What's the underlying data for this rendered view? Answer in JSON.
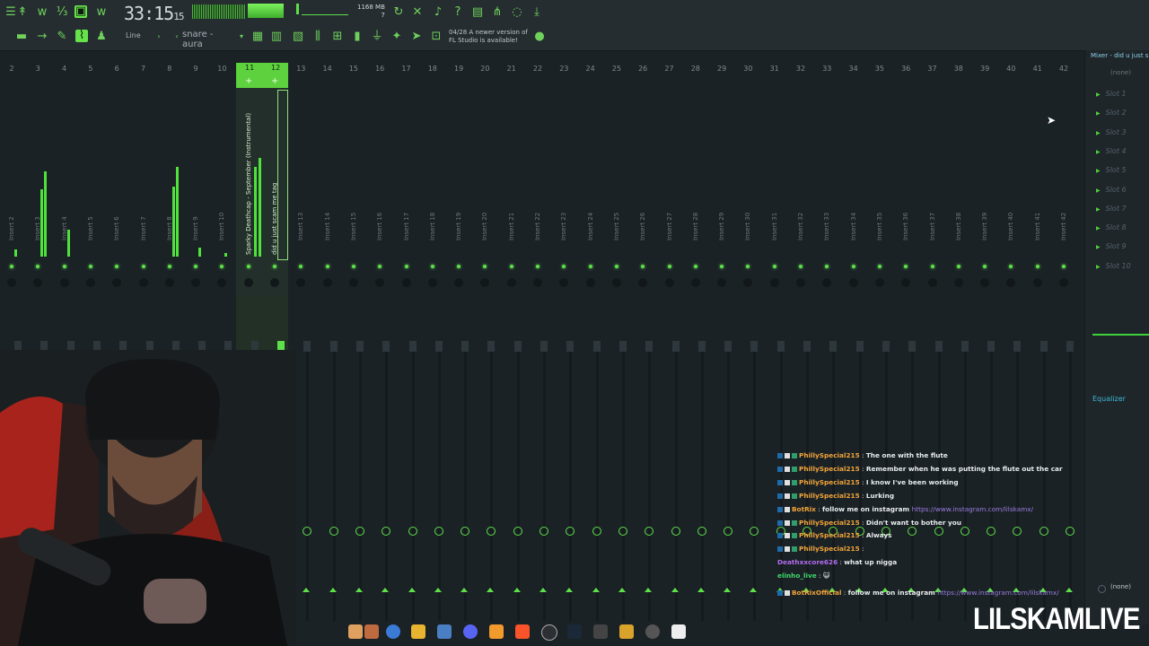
{
  "toolbar": {
    "timecode_main": "33:15",
    "timecode_sub": "15",
    "memory_top": "1168 MB",
    "memory_bottom": "7",
    "pattern_label": "snare - aura",
    "snap_mode": "Line",
    "news_line1": "04/28  A newer version of",
    "news_line2": "FL Studio is available!",
    "accent_color": "#5ee04a"
  },
  "ruler": {
    "numbers": [
      "2",
      "3",
      "4",
      "5",
      "6",
      "7",
      "8",
      "9",
      "10",
      "11",
      "12",
      "13",
      "14",
      "15",
      "16",
      "17",
      "18",
      "19",
      "20",
      "21",
      "22",
      "23",
      "24",
      "25",
      "26",
      "27",
      "28",
      "29",
      "30",
      "31",
      "32",
      "33",
      "34",
      "35",
      "36",
      "37",
      "38",
      "39",
      "40",
      "41",
      "42"
    ]
  },
  "mixer": {
    "selected_tracks": [
      "11",
      "12"
    ],
    "tracks": [
      "Insert 2",
      "Insert 3",
      "Insert 4",
      "Insert 5",
      "Insert 6",
      "Insert 7",
      "Insert 8",
      "Insert 9",
      "Insert 10",
      "Sparky Deathcap - September (Instrumental)",
      "did u just scam me tag",
      "Insert 13",
      "Insert 14",
      "Insert 15",
      "Insert 16",
      "Insert 17",
      "Insert 18",
      "Insert 19",
      "Insert 20",
      "Insert 21",
      "Insert 22",
      "Insert 23",
      "Insert 24",
      "Insert 25",
      "Insert 26",
      "Insert 27",
      "Insert 28",
      "Insert 29",
      "Insert 30",
      "Insert 31",
      "Insert 32",
      "Insert 33",
      "Insert 34",
      "Insert 35",
      "Insert 36",
      "Insert 37",
      "Insert 38",
      "Insert 39",
      "Insert 40",
      "Insert 41",
      "Insert 42"
    ]
  },
  "right_panel": {
    "title": "Mixer - did u just s",
    "input_none": "(none)",
    "slots": [
      "Slot 1",
      "Slot 2",
      "Slot 3",
      "Slot 4",
      "Slot 5",
      "Slot 6",
      "Slot 7",
      "Slot 8",
      "Slot 9",
      "Slot 10"
    ],
    "equalizer": "Equalizer",
    "output_none": "(none)"
  },
  "chat": [
    {
      "user": "PhillySpecial215",
      "msg": "The one with the flute",
      "color": "#f0a43a",
      "badges": 3
    },
    {
      "user": "PhillySpecial215",
      "msg": "Remember when he was putting the flute out the car",
      "color": "#f0a43a",
      "badges": 3
    },
    {
      "user": "PhillySpecial215",
      "msg": "I know I've been working",
      "color": "#f0a43a",
      "badges": 3
    },
    {
      "user": "PhillySpecial215",
      "msg": "Lurking",
      "color": "#f0a43a",
      "badges": 3
    },
    {
      "user": "BotRix",
      "msg": "follow me on instagram ",
      "link": "https://www.instagram.com/lilskamx/",
      "color": "#f0a43a",
      "badges": 2
    },
    {
      "user": "PhillySpecial215",
      "msg": "Didn't want to bother you",
      "color": "#f0a43a",
      "badges": 3
    },
    {
      "user": "PhillySpecial215",
      "msg": "Always",
      "color": "#f0a43a",
      "badges": 3
    },
    {
      "user": "PhillySpecial215",
      "msg": "",
      "color": "#f0a43a",
      "badges": 3
    },
    {
      "user": "Deathxxcore626",
      "msg": "what up nigga",
      "color": "#b36cf0",
      "badges": 0
    },
    {
      "user": "elinho_live",
      "msg": "😺",
      "color": "#3ed96b",
      "badges": 0
    },
    {
      "user": "BotRixOfficial",
      "msg": "follow me on instagram ",
      "link": "https://www.instagram.com/lilskamx/",
      "color": "#f0a43a",
      "badges": 2
    }
  ],
  "stream_logo": "LILSKAMLIVE"
}
